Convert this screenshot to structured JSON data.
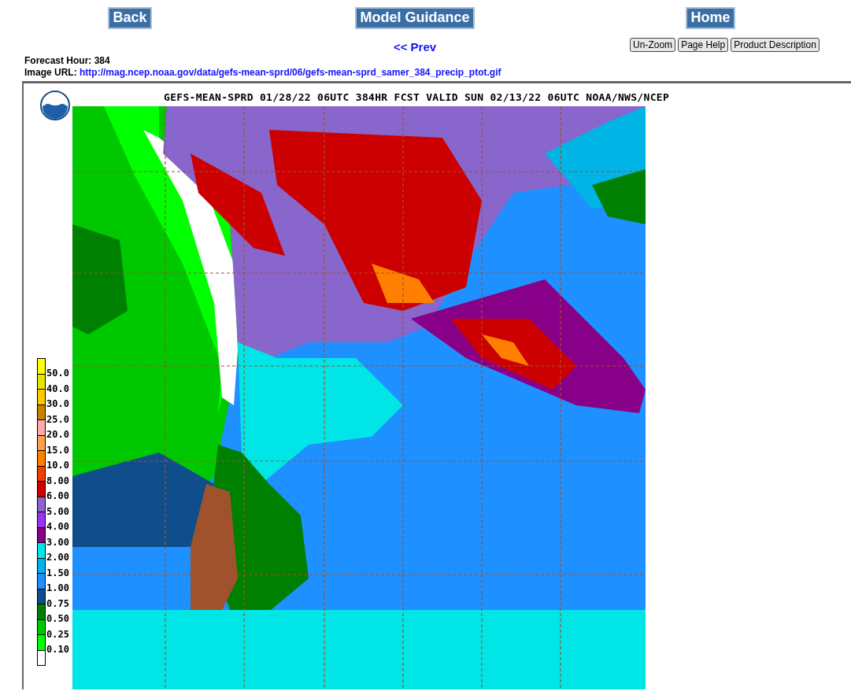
{
  "nav_buttons": [
    "Back",
    "Model Guidance",
    "Home"
  ],
  "prev_link": "<< Prev",
  "tool_buttons": [
    "Un-Zoom",
    "Page Help",
    "Product Description"
  ],
  "forecast_hour": {
    "label": "Forecast Hour:",
    "value": "384"
  },
  "image_url": {
    "label": "Image URL:",
    "link": "http://mag.ncep.noaa.gov/data/gefs-mean-sprd/06/gefs-mean-sprd_samer_384_precip_ptot.gif"
  },
  "map": {
    "title": "GEFS-MEAN-SPRD 01/28/22 06UTC 384HR FCST VALID SUN 02/13/22 06UTC NOAA/NWS/NCEP",
    "legend": [
      {
        "label": "50.0",
        "color": "#ffff00"
      },
      {
        "label": "40.0",
        "color": "#e6e600"
      },
      {
        "label": "30.0",
        "color": "#ffc800"
      },
      {
        "label": "25.0",
        "color": "#c88200"
      },
      {
        "label": "20.0",
        "color": "#ffaaaa"
      },
      {
        "label": "15.0",
        "color": "#ffa050"
      },
      {
        "label": "10.0",
        "color": "#ff8000"
      },
      {
        "label": "8.00",
        "color": "#ee4000"
      },
      {
        "label": "6.00",
        "color": "#cc0000"
      },
      {
        "label": "5.00",
        "color": "#8866cc"
      },
      {
        "label": "4.00",
        "color": "#9933ee"
      },
      {
        "label": "3.00",
        "color": "#880088"
      },
      {
        "label": "2.00",
        "color": "#00e6e6"
      },
      {
        "label": "1.50",
        "color": "#00b4e6"
      },
      {
        "label": "1.00",
        "color": "#1e90ff"
      },
      {
        "label": "0.75",
        "color": "#104e8b"
      },
      {
        "label": "0.50",
        "color": "#008000"
      },
      {
        "label": "0.25",
        "color": "#00c800"
      },
      {
        "label": "0.10",
        "color": "#00ff00"
      }
    ]
  }
}
